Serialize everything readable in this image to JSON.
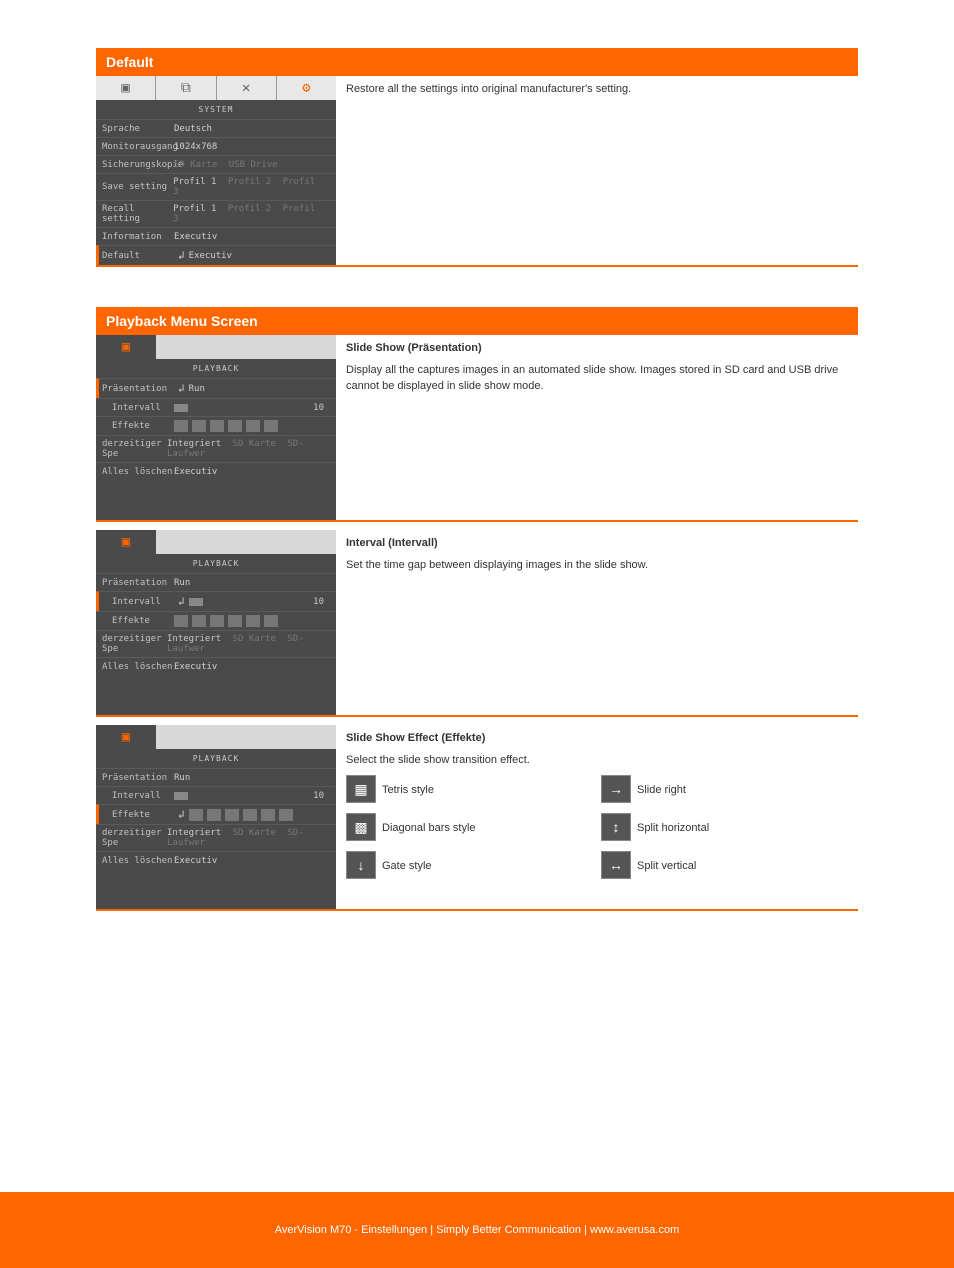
{
  "sections": {
    "system": {
      "header": "Default",
      "ui": {
        "title": "SYSTEM",
        "rows": {
          "sprache": {
            "label": "Sprache",
            "value": "Deutsch"
          },
          "monitor": {
            "label": "Monitorausgang",
            "value": "1024x768"
          },
          "sicherung": {
            "label": "Sicherungskopie",
            "v1": "SD Karte",
            "v2": "USB Drive"
          },
          "save": {
            "label": "Save setting",
            "v1": "Profil 1",
            "v2": "Profil 2",
            "v3": "Profil 3"
          },
          "recall": {
            "label": "Recall setting",
            "v1": "Profil 1",
            "v2": "Profil 2",
            "v3": "Profil 3"
          },
          "info": {
            "label": "Information",
            "value": "Executiv"
          },
          "default": {
            "label": "Default",
            "value": "Executiv"
          }
        }
      },
      "desc": "Restore all the settings into original manufacturer's setting."
    },
    "playback": {
      "header": "Playback Menu Screen",
      "ui_title": "PLAYBACK",
      "rows": {
        "pras": {
          "label": "Präsentation",
          "value": "Run"
        },
        "intervall": {
          "label": "Intervall",
          "value": "10"
        },
        "effekte": {
          "label": "Effekte"
        },
        "speicher": {
          "label": "derzeitiger Spe",
          "v1": "Integriert",
          "v2": "SD Karte",
          "v3": "SD-Laufwer"
        },
        "loeschen": {
          "label": "Alles löschen",
          "value": "Executiv"
        }
      },
      "slideshow": {
        "title": "Slide Show (Präsentation)",
        "body": "Display all the captures images in an automated slide show. Images stored in SD card and USB drive cannot be displayed in slide show mode."
      },
      "interval": {
        "title": "Interval (Intervall)",
        "body": "Set the time gap between displaying images in the slide show."
      },
      "effect": {
        "title": "Slide Show Effect (Effekte)",
        "body": "Select the slide show transition effect.",
        "icons": [
          {
            "emoji": "▦",
            "label": "Tetris style"
          },
          {
            "emoji": "▩",
            "label": "Diagonal bars style"
          },
          {
            "emoji": "↓",
            "label": "Gate style"
          },
          {
            "emoji": "→",
            "label": "Slide right"
          },
          {
            "emoji": "↕",
            "label": "Split horizontal"
          },
          {
            "emoji": "↔",
            "label": "Split vertical"
          }
        ]
      }
    }
  },
  "footer": "AverVision M70 - Einstellungen | Simply Better Communication | www.averusa.com"
}
